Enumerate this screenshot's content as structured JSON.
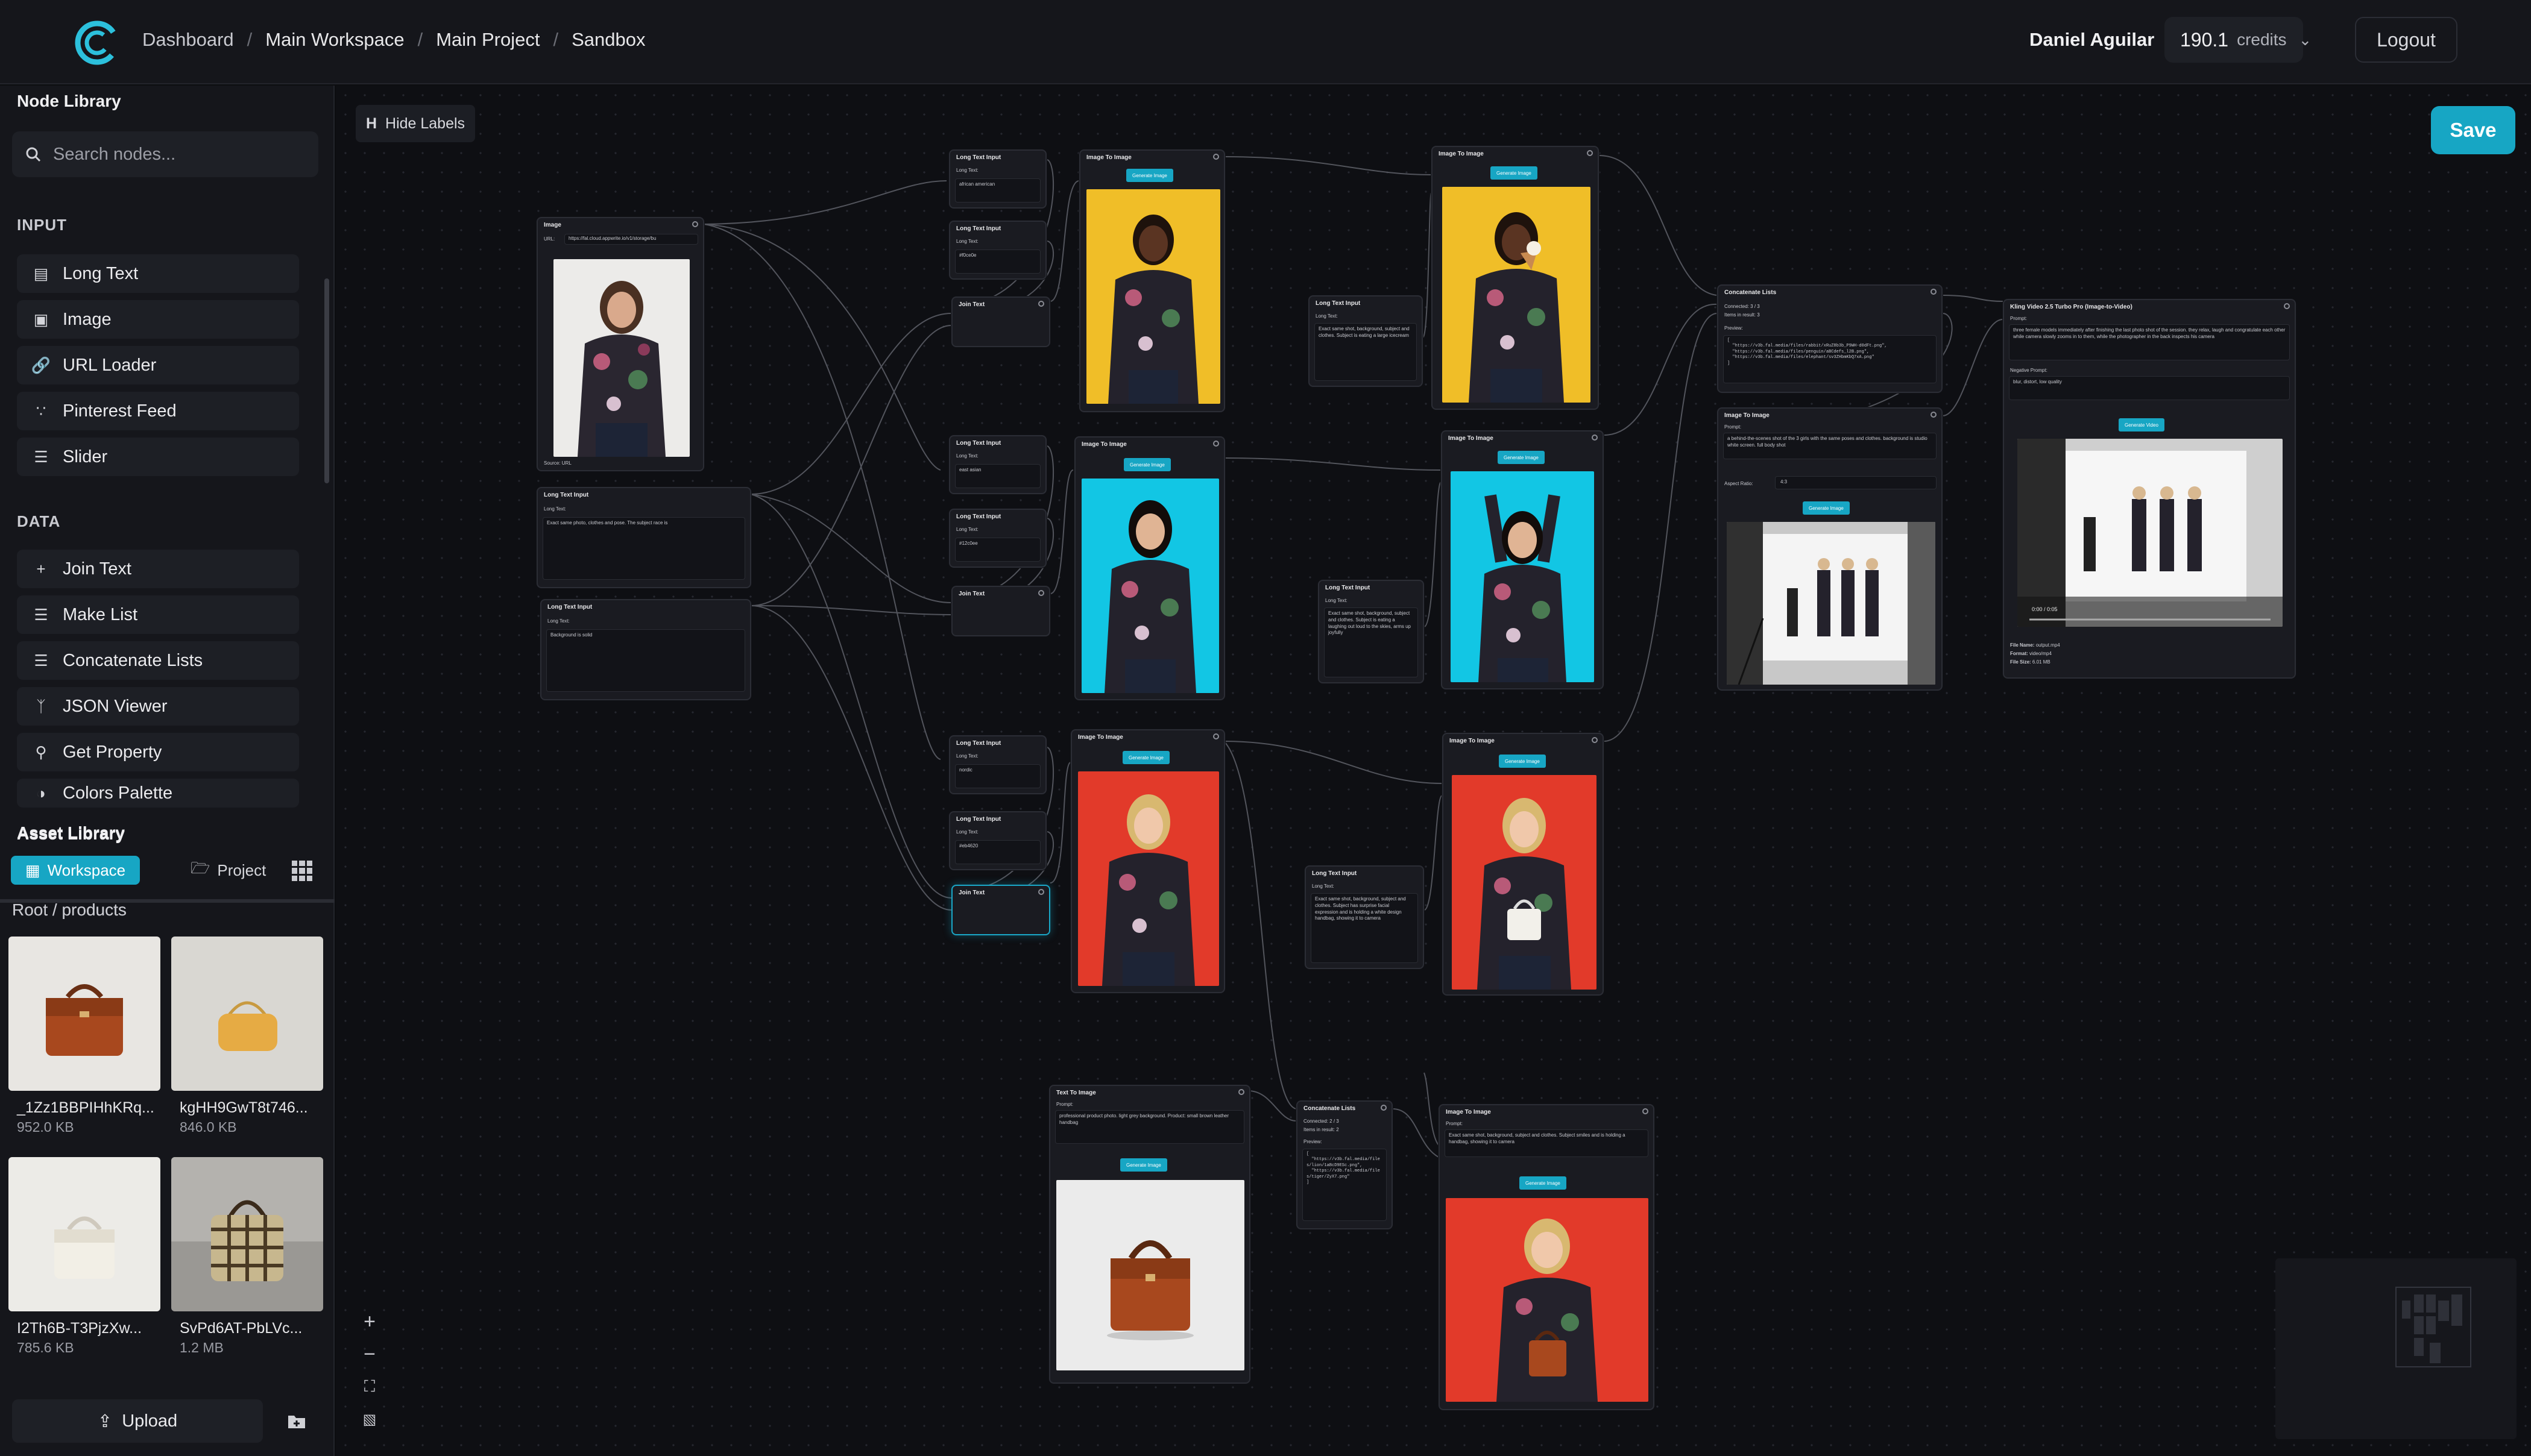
{
  "breadcrumb": [
    "Dashboard",
    "Main Workspace",
    "Main Project",
    "Sandbox"
  ],
  "user": {
    "name": "Daniel Aguilar",
    "credits_value": "190.1",
    "credits_unit": "credits",
    "logout": "Logout"
  },
  "sidebar": {
    "node_library_title": "Node Library",
    "search_placeholder": "Search nodes...",
    "input_section": "INPUT",
    "input_items": [
      {
        "label": "Long Text",
        "icon": "document-icon"
      },
      {
        "label": "Image",
        "icon": "image-icon"
      },
      {
        "label": "URL Loader",
        "icon": "link-icon"
      },
      {
        "label": "Pinterest Feed",
        "icon": "rss-icon"
      },
      {
        "label": "Slider",
        "icon": "sliders-icon"
      }
    ],
    "data_section": "DATA",
    "data_items": [
      {
        "label": "Join Text",
        "icon": "plus-icon"
      },
      {
        "label": "Make List",
        "icon": "list-icon"
      },
      {
        "label": "Concatenate Lists",
        "icon": "list-icon"
      },
      {
        "label": "JSON Viewer",
        "icon": "branch-icon"
      },
      {
        "label": "Get Property",
        "icon": "key-icon"
      },
      {
        "label": "Colors Palette",
        "icon": "palette-icon"
      }
    ]
  },
  "assets": {
    "title": "Asset Library",
    "tab_workspace": "Workspace",
    "tab_project": "Project",
    "path": "Root / products",
    "items": [
      {
        "name": "_1Zz1BBPIHhKRq...",
        "size": "952.0 KB"
      },
      {
        "name": "kgHH9GwT8t746...",
        "size": "846.0 KB"
      },
      {
        "name": "I2Th6B-T3PjzXw...",
        "size": "785.6 KB"
      },
      {
        "name": "SvPd6AT-PbLVc...",
        "size": "1.2 MB"
      }
    ],
    "upload": "Upload"
  },
  "canvas": {
    "hide_labels": "Hide Labels",
    "hide_labels_key": "H",
    "save": "Save"
  },
  "nodes": {
    "image_src": {
      "title": "Image",
      "url_label": "URL:",
      "url": "https://fal.cloud.appwrite.io/v1/storage/bu",
      "caption": "Source: URL"
    },
    "lt_a": {
      "title": "Long Text Input",
      "label": "Long Text:",
      "value": "Exact same photo, clothes and pose. The subject race is"
    },
    "lt_b": {
      "title": "Long Text Input",
      "label": "Long Text:",
      "value": "Background is solid"
    },
    "lt_r1": {
      "title": "Long Text Input",
      "label": "Long Text:",
      "value": "african american"
    },
    "lt_c1": {
      "title": "Long Text Input",
      "label": "Long Text:",
      "value": "#f0ce0e"
    },
    "join1": {
      "title": "Join Text"
    },
    "lt_r2": {
      "title": "Long Text Input",
      "label": "Long Text:",
      "value": "east asian"
    },
    "lt_c2": {
      "title": "Long Text Input",
      "label": "Long Text:",
      "value": "#12c0ee"
    },
    "join2": {
      "title": "Join Text"
    },
    "lt_r3": {
      "title": "Long Text Input",
      "label": "Long Text:",
      "value": "nordic"
    },
    "lt_c3": {
      "title": "Long Text Input",
      "label": "Long Text:",
      "value": "#eb4620"
    },
    "join3": {
      "title": "Join Text"
    },
    "i2i_1": {
      "title": "Image To Image",
      "button": "Generate Image"
    },
    "i2i_2": {
      "title": "Image To Image",
      "button": "Generate Image"
    },
    "i2i_3": {
      "title": "Image To Image",
      "button": "Generate Image"
    },
    "lt_p1": {
      "title": "Long Text Input",
      "label": "Long Text:",
      "value": "Exact same shot, background, subject and clothes. Subject is eating a large icecream"
    },
    "lt_p2": {
      "title": "Long Text Input",
      "label": "Long Text:",
      "value": "Exact same shot, background, subject and clothes. Subject is eating a laughing out loud to the skies, arms up joyfully"
    },
    "lt_p3": {
      "title": "Long Text Input",
      "label": "Long Text:",
      "value": "Exact same shot, background, subject and clothes. Subject has surprise facial expression and is holding a white design handbag, showing it to camera"
    },
    "i2i_4": {
      "title": "Image To Image",
      "button": "Generate Image"
    },
    "i2i_5": {
      "title": "Image To Image",
      "button": "Generate Image"
    },
    "i2i_6": {
      "title": "Image To Image",
      "button": "Generate Image"
    },
    "concat1": {
      "title": "Concatenate Lists",
      "connected": "Connected: 3 / 3",
      "items": "Items in result: 3",
      "preview_label": "Preview:",
      "preview": "[\n  \"https://v3b.fal.media/files/rabbit/xRuZ8b3b_P9WH-d0dFt.png\",\n  \"https://v3b.fal.media/files/penguin/aBCdefs_l2B.png\",\n  \"https://v3b.fal.media/files/elephant/sv3ZHbmKbQ7xA.png\"\n]"
    },
    "i2i_7": {
      "title": "Image To Image",
      "prompt_label": "Prompt:",
      "prompt": "a behind-the-scenes shot of the 3 girls with the same poses and clothes. background is studio white screen. full body shot",
      "aspect_label": "Aspect Ratio:",
      "aspect": "4:3",
      "button": "Generate Image"
    },
    "kling": {
      "title": "Kling Video 2.5 Turbo Pro (Image-to-Video)",
      "prompt_label": "Prompt:",
      "prompt": "three female models immediately after finishing the last photo shot of the session. they relax, laugh and congratulate each other while camera slowly zooms in to them, while the photographer in the back inspects his camera",
      "neg_label": "Negative Prompt:",
      "neg": "blur, distort, low quality",
      "button": "Generate Video",
      "time": "0:00 / 0:05",
      "file_name_label": "File Name:",
      "file_name": "output.mp4",
      "format_label": "Format:",
      "format": "video/mp4",
      "size_label": "File Size:",
      "size": "6.01 MB"
    },
    "t2i": {
      "title": "Text To Image",
      "prompt_label": "Prompt:",
      "prompt": "professional product photo. light grey background. Product: small brown leather handbag",
      "button": "Generate Image"
    },
    "concat2": {
      "title": "Concatenate Lists",
      "connected": "Connected: 2 / 3",
      "items": "Items in result: 2",
      "preview_label": "Preview:",
      "preview": "[\n  \"https://v3b.fal.media/files/lion/1aBcD9ESc.png\",\n  \"https://v3b.fal.media/files/tiger/ZyX7.png\"\n]"
    },
    "i2i_8": {
      "title": "Image To Image",
      "prompt_label": "Prompt:",
      "prompt": "Exact same shot, background, subject and clothes. Subject smiles and  is holding a  handbag, showing it to camera",
      "button": "Generate Image"
    }
  },
  "colors": {
    "accent": "#17a6c4",
    "yellow_bg": "#f0be28",
    "cyan_bg": "#12c6e4",
    "red_bg": "#e23a2a"
  }
}
